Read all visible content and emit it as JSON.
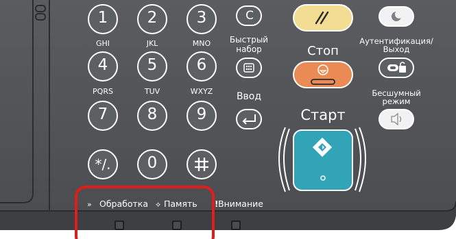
{
  "keypad": {
    "keys": {
      "k1": "1",
      "k2": "2",
      "k3": "3",
      "k4": "4",
      "k5": "5",
      "k6": "6",
      "k7": "7",
      "k8": "8",
      "k9": "9",
      "star": "*/.",
      "k0": "0",
      "hash": "#"
    },
    "letters": {
      "k4": "GHI",
      "k5": "JKL",
      "k6": "MNO",
      "k7": "PQRS",
      "k8": "TUV",
      "k9": "WXYZ"
    }
  },
  "function_keys": {
    "clear": "C",
    "speed_dial": "Быстрый\nнабор",
    "enter": "Ввод",
    "reset_icon": "reset-icon",
    "energy_saver_icon": "moon-icon",
    "stop": "Стоп",
    "start": "Старт",
    "auth": "Аутентификация/\nВыход",
    "mute": "Бесшумный\nрежим"
  },
  "indicators": {
    "processing": "Обработка",
    "memory": "Память",
    "attention": "Внимание"
  },
  "colors": {
    "panel": "#55575a",
    "key": "#5d6063",
    "key_border": "#ffffff",
    "reset_key": "#f3dd93",
    "stop_key": "#ea8a55",
    "start_key": "#31a4b7",
    "highlight": "#e21b1b"
  }
}
